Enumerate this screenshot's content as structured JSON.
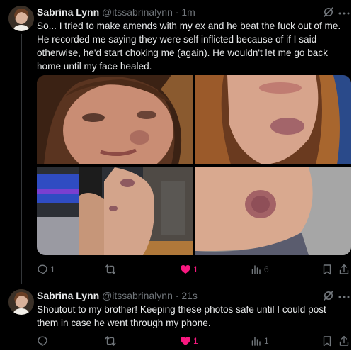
{
  "colors": {
    "background": "#000000",
    "text": "#e7e9ea",
    "muted": "#71767b",
    "like": "#f91880"
  },
  "posts": [
    {
      "name": "Sabrina Lynn",
      "handle": "@itssabrinalynn",
      "separator": "·",
      "time": "1m",
      "text": "So... I tried to make amends with my ex and he beat the fuck out of me. He recorded me saying they were self inflicted because of if I said otherwise, he'd start choking me (again). He wouldn't let me go back home until my face healed.",
      "media": [
        "photo-face-bruise",
        "photo-chin-bruise",
        "photo-arm-mirror",
        "photo-arm-bruise"
      ],
      "actions": {
        "reply_icon": "reply-icon",
        "replies": "1",
        "repost_icon": "repost-icon",
        "reposts": "",
        "like_icon": "heart-filled-icon",
        "likes": "1",
        "views_icon": "views-icon",
        "views": "6",
        "bookmark_icon": "bookmark-icon",
        "share_icon": "share-icon"
      }
    },
    {
      "name": "Sabrina Lynn",
      "handle": "@itssabrinalynn",
      "separator": "·",
      "time": "21s",
      "text": "Shoutout to my brother! Keeping these photos safe until I could post them in case he went through my phone.",
      "actions": {
        "reply_icon": "reply-icon",
        "replies": "",
        "repost_icon": "repost-icon",
        "reposts": "",
        "like_icon": "heart-filled-icon",
        "likes": "1",
        "views_icon": "views-icon",
        "views": "1",
        "bookmark_icon": "bookmark-icon",
        "share_icon": "share-icon"
      }
    }
  ]
}
